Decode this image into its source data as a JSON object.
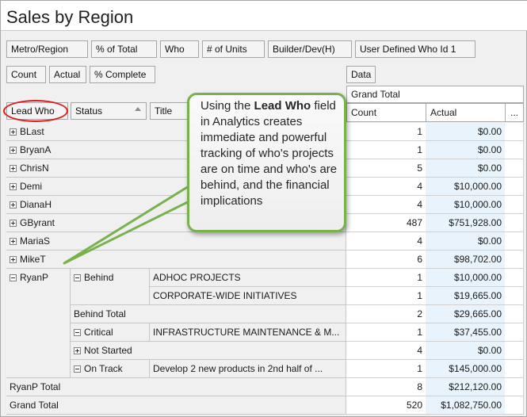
{
  "report": {
    "title": "Sales by Region"
  },
  "filter_fields": [
    "Metro/Region",
    "% of Total",
    "Who",
    "# of Units",
    "Builder/Dev(H)",
    "User Defined Who Id 1"
  ],
  "data_fields": [
    "Count",
    "Actual",
    "% Complete"
  ],
  "data_header": "Data",
  "row_headers": {
    "lead_who": "Lead Who",
    "status": "Status",
    "title": "Title"
  },
  "grand_total_header": "Grand Total",
  "columns": {
    "count": "Count",
    "actual": "Actual",
    "more": "..."
  },
  "rows": [
    {
      "lead": "BLast",
      "count": "1",
      "actual": "$0.00"
    },
    {
      "lead": "BryanA",
      "count": "1",
      "actual": "$0.00"
    },
    {
      "lead": "ChrisN",
      "count": "5",
      "actual": "$0.00"
    },
    {
      "lead": "Demi",
      "count": "4",
      "actual": "$10,000.00"
    },
    {
      "lead": "DianaH",
      "count": "4",
      "actual": "$10,000.00"
    },
    {
      "lead": "GByrant",
      "count": "487",
      "actual": "$751,928.00"
    },
    {
      "lead": "MariaS",
      "count": "4",
      "actual": "$0.00"
    },
    {
      "lead": "MikeT",
      "count": "6",
      "actual": "$98,702.00"
    }
  ],
  "ryanp": {
    "lead": "RyanP",
    "behind_status": "Behind",
    "behind_items": [
      {
        "title": "ADHOC PROJECTS",
        "count": "1",
        "actual": "$10,000.00"
      },
      {
        "title": "CORPORATE-WIDE INITIATIVES",
        "count": "1",
        "actual": "$19,665.00"
      }
    ],
    "behind_total": {
      "label": "Behind Total",
      "count": "2",
      "actual": "$29,665.00"
    },
    "critical": {
      "status": "Critical",
      "title": "INFRASTRUCTURE MAINTENANCE & M...",
      "count": "1",
      "actual": "$37,455.00"
    },
    "not_started": {
      "status": "Not Started",
      "count": "4",
      "actual": "$0.00"
    },
    "on_track": {
      "status": "On Track",
      "title": "Develop 2 new products in 2nd half of ...",
      "count": "1",
      "actual": "$145,000.00"
    },
    "total": {
      "label": "RyanP Total",
      "count": "8",
      "actual": "$212,120.00"
    }
  },
  "grand_total": {
    "label": "Grand Total",
    "count": "520",
    "actual": "$1,082,750.00"
  },
  "callout": {
    "text_before": "Using the ",
    "bold": "Lead Who",
    "text_after": " field in Analytics creates immediate and powerful tracking of who's projects are on time and who's are behind, and the financial implications"
  },
  "colors": {
    "callout_border": "#77b24d",
    "highlight_circle": "#e0191b",
    "actual_cell_bg": "#e8f3fb"
  }
}
